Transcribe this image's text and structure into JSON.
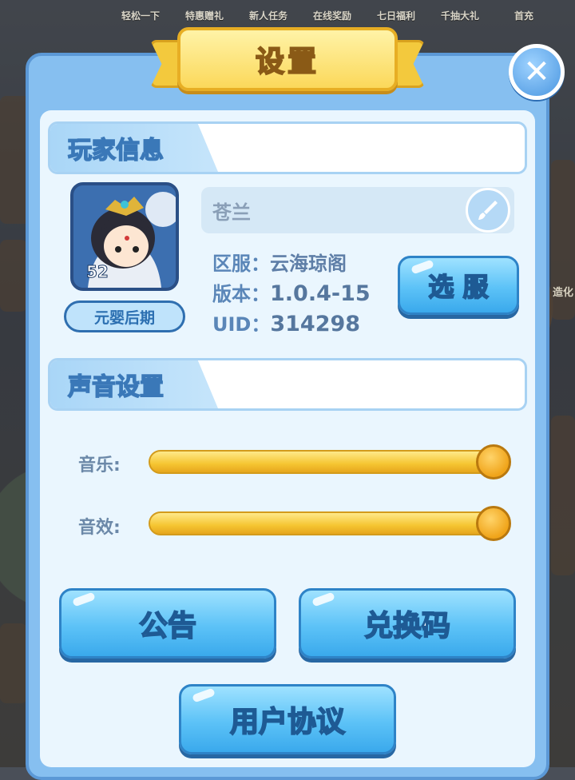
{
  "background_bar": {
    "items": [
      "轻松一下",
      "特惠赠礼",
      "新人任务",
      "在线奖励",
      "七日福利",
      "千抽大礼",
      "首充"
    ],
    "side_text": "造化"
  },
  "dialog": {
    "title": "设置",
    "close_icon": "close-icon"
  },
  "player_info": {
    "section_title": "玩家信息",
    "level": "52",
    "realm": "元婴后期",
    "name": "苍兰",
    "server_label": "区服：",
    "server_value": "云海琼阁",
    "version_label": "版本：",
    "version_value": "1.0.4-15",
    "uid_label": "UID：",
    "uid_value": "314298",
    "select_server_label": "选 服"
  },
  "sound_settings": {
    "section_title": "声音设置",
    "music_label": "音乐:",
    "music_level": 1.0,
    "effects_label": "音效:",
    "effects_level": 1.0
  },
  "buttons": {
    "announcement": "公告",
    "redeem_code": "兑换码",
    "user_agreement": "用户协议"
  },
  "colors": {
    "panel": "#86bff0",
    "button_blue": "#5cc2f7",
    "slider_gold": "#f5c531",
    "title_gold": "#fbd85a"
  }
}
